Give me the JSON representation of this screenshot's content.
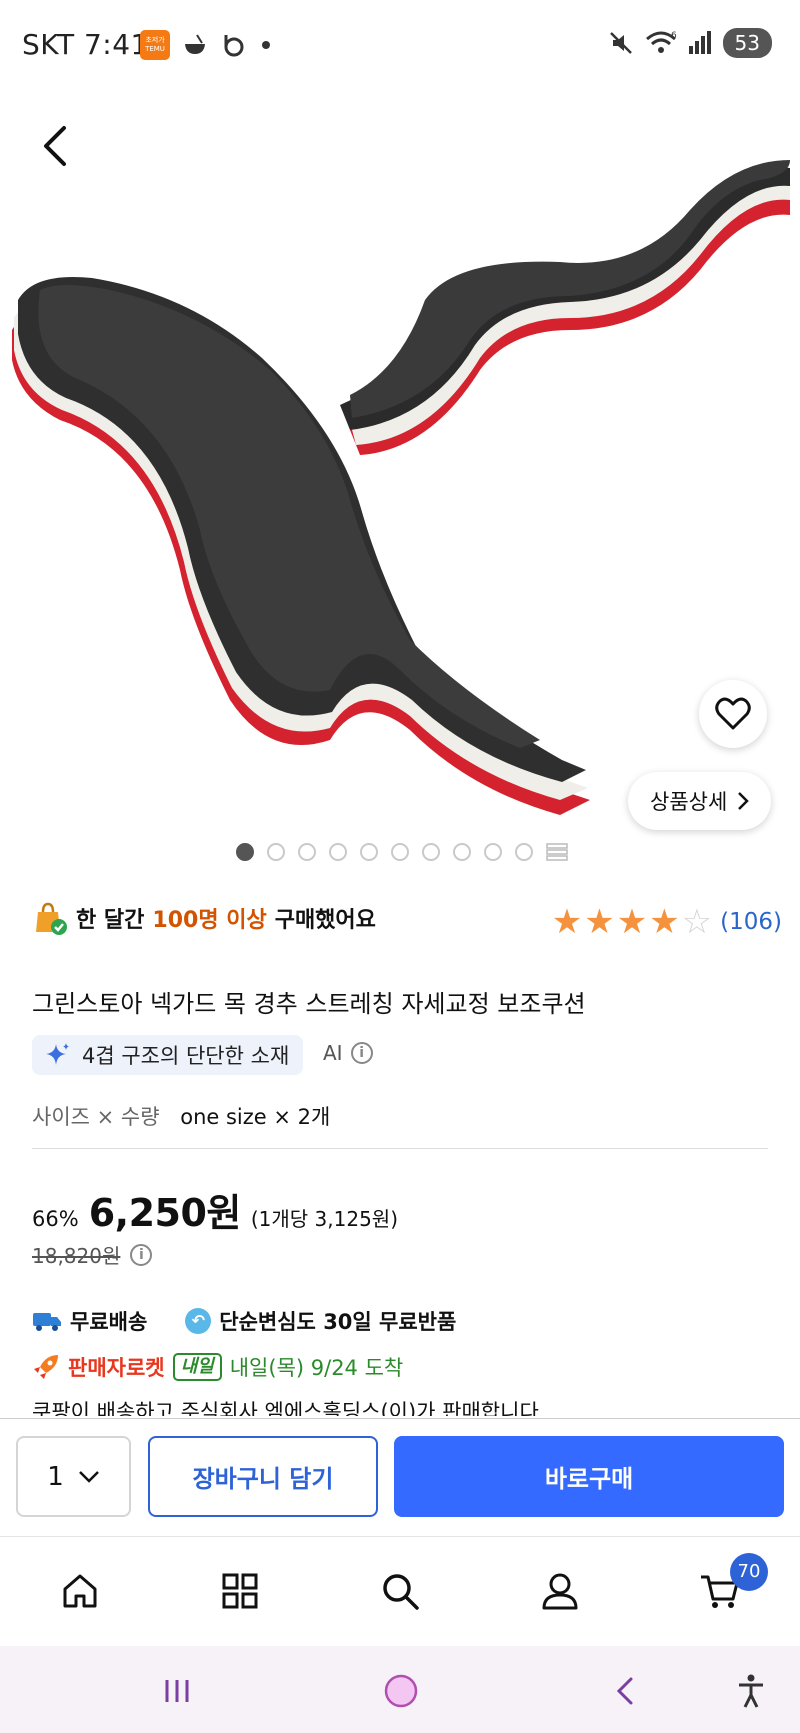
{
  "status_bar": {
    "carrier_time": "SKT 7:41",
    "temu_icon_text": "초저가 TEMU",
    "battery": "53"
  },
  "hero": {
    "detail_button_label": "상품상세",
    "image_count": 10,
    "active_index": 0
  },
  "purchase_info": {
    "prefix": "한 달간",
    "highlight": "100명 이상",
    "suffix": "구매했어요"
  },
  "rating": {
    "stars": 4,
    "max_stars": 5,
    "review_count": "(106)",
    "star_color": "#f5923e"
  },
  "product": {
    "title": "그린스토아 넥가드 목 경추 스트레칭 자세교정 보조쿠션",
    "ai_tag": "4겹 구조의 단단한 소재",
    "ai_label": "AI",
    "option_label": "사이즈 × 수량",
    "option_value": "one size × 2개"
  },
  "price": {
    "discount": "66%",
    "current": "6,250원",
    "unit": "(1개당 3,125원)",
    "original": "18,820원"
  },
  "shipping": {
    "free_delivery": "무료배송",
    "return_policy": "단순변심도 30일 무료반품",
    "rocket_label": "판매자로켓",
    "tomorrow_badge": "내일",
    "arrival": "내일(목) 9/24 도착",
    "seller_line": "쿠팡이 배송하고 주식회사 엠에스홀딩스(이)가 판매합니다"
  },
  "actions": {
    "quantity": "1",
    "cart_button": "장바구니 담기",
    "buy_button": "바로구매",
    "accent_color": "#346aff"
  },
  "bottom_nav": {
    "items": [
      "home-icon",
      "category-icon",
      "search-icon",
      "my-account-icon",
      "cart-icon"
    ],
    "cart_count": "70"
  }
}
